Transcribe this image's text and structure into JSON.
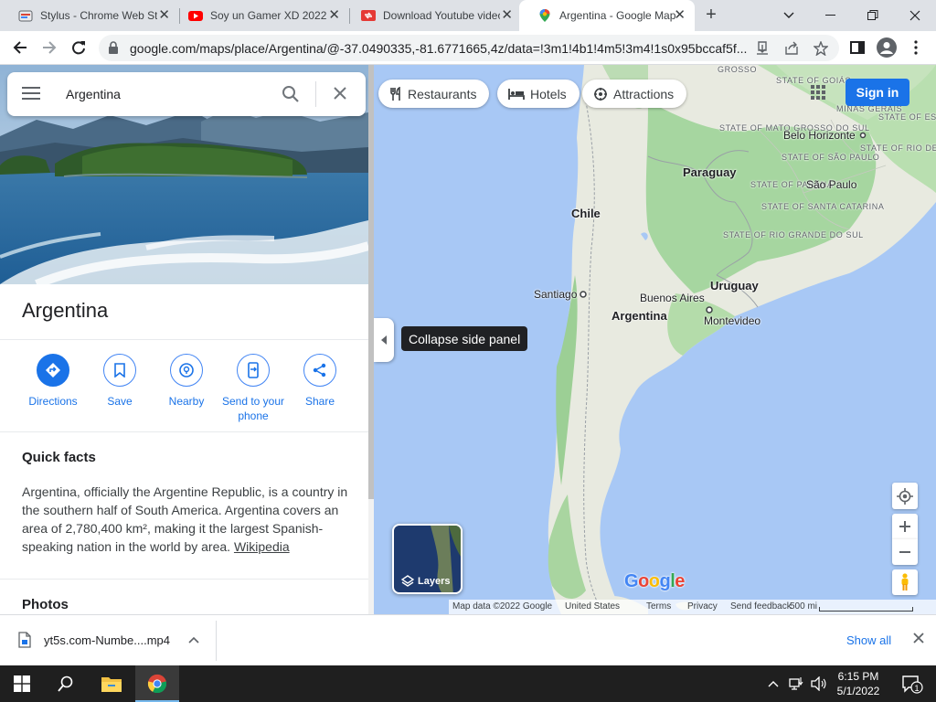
{
  "tabs": [
    {
      "title": "Stylus - Chrome Web Store",
      "icon": "stylus-icon"
    },
    {
      "title": "Soy un Gamer XD 2022",
      "icon": "youtube-icon"
    },
    {
      "title": "Download Youtube videos",
      "icon": "yt5s-icon"
    },
    {
      "title": "Argentina - Google Maps",
      "icon": "google-maps-icon",
      "active": true
    }
  ],
  "toolbar": {
    "url": "google.com/maps/place/Argentina/@-37.0490335,-81.6771665,4z/data=!3m1!4b1!4m5!3m4!1s0x95bccaf5f..."
  },
  "search": {
    "query": "Argentina"
  },
  "place": {
    "title": "Argentina",
    "actions": [
      {
        "label": "Directions"
      },
      {
        "label": "Save"
      },
      {
        "label": "Nearby"
      },
      {
        "label": "Send to your phone"
      },
      {
        "label": "Share"
      }
    ],
    "quick_facts_heading": "Quick facts",
    "quick_facts_text": "Argentina, officially the Argentine Republic, is a country in the southern half of South America. Argentina covers an area of 2,780,400 km², making it the largest Spanish-speaking nation in the world by area.",
    "quick_facts_link": "Wikipedia",
    "photos_heading": "Photos"
  },
  "map": {
    "chips": [
      "Restaurants",
      "Hotels",
      "Attractions"
    ],
    "signin": "Sign in",
    "tooltip": "Collapse side panel",
    "layers_label": "Layers",
    "logo": "Google",
    "labels": {
      "grosso": "GROSSO",
      "goias": "STATE OF GOIÁS",
      "minas": "MINAS GERAIS",
      "espirito": "STATE OF ESPÍRITO SANTO",
      "mato_grosso_sul": "STATE OF MATO GROSSO DO SUL",
      "belo_horizonte": "Belo Horizonte",
      "sao_paulo_state": "STATE OF SÃO PAULO",
      "rio_state": "STATE OF RIO DE JANEIRO",
      "parana": "STATE OF PARANÁ",
      "sao_paulo": "São Paulo",
      "santa_catarina": "STATE OF SANTA CATARINA",
      "rio_grande": "STATE OF RIO GRANDE DO SUL",
      "paraguay": "Paraguay",
      "chile": "Chile",
      "uruguay": "Uruguay",
      "santiago": "Santiago",
      "buenos_aires": "Buenos Aires",
      "argentina": "Argentina",
      "montevideo": "Montevideo"
    },
    "attribution": {
      "map_data": "Map data ©2022 Google",
      "country": "United States",
      "terms": "Terms",
      "privacy": "Privacy",
      "feedback": "Send feedback",
      "scale": "500 mi"
    }
  },
  "downloads": {
    "file": "yt5s.com-Numbe....mp4",
    "show_all": "Show all"
  },
  "taskbar": {
    "time": "6:15 PM",
    "date": "5/1/2022",
    "notification_count": "1"
  },
  "colors": {
    "accent": "#1a73e8",
    "water": "#a8c8f5",
    "land": "#e8eae0",
    "forest": "#a6d6a0"
  }
}
